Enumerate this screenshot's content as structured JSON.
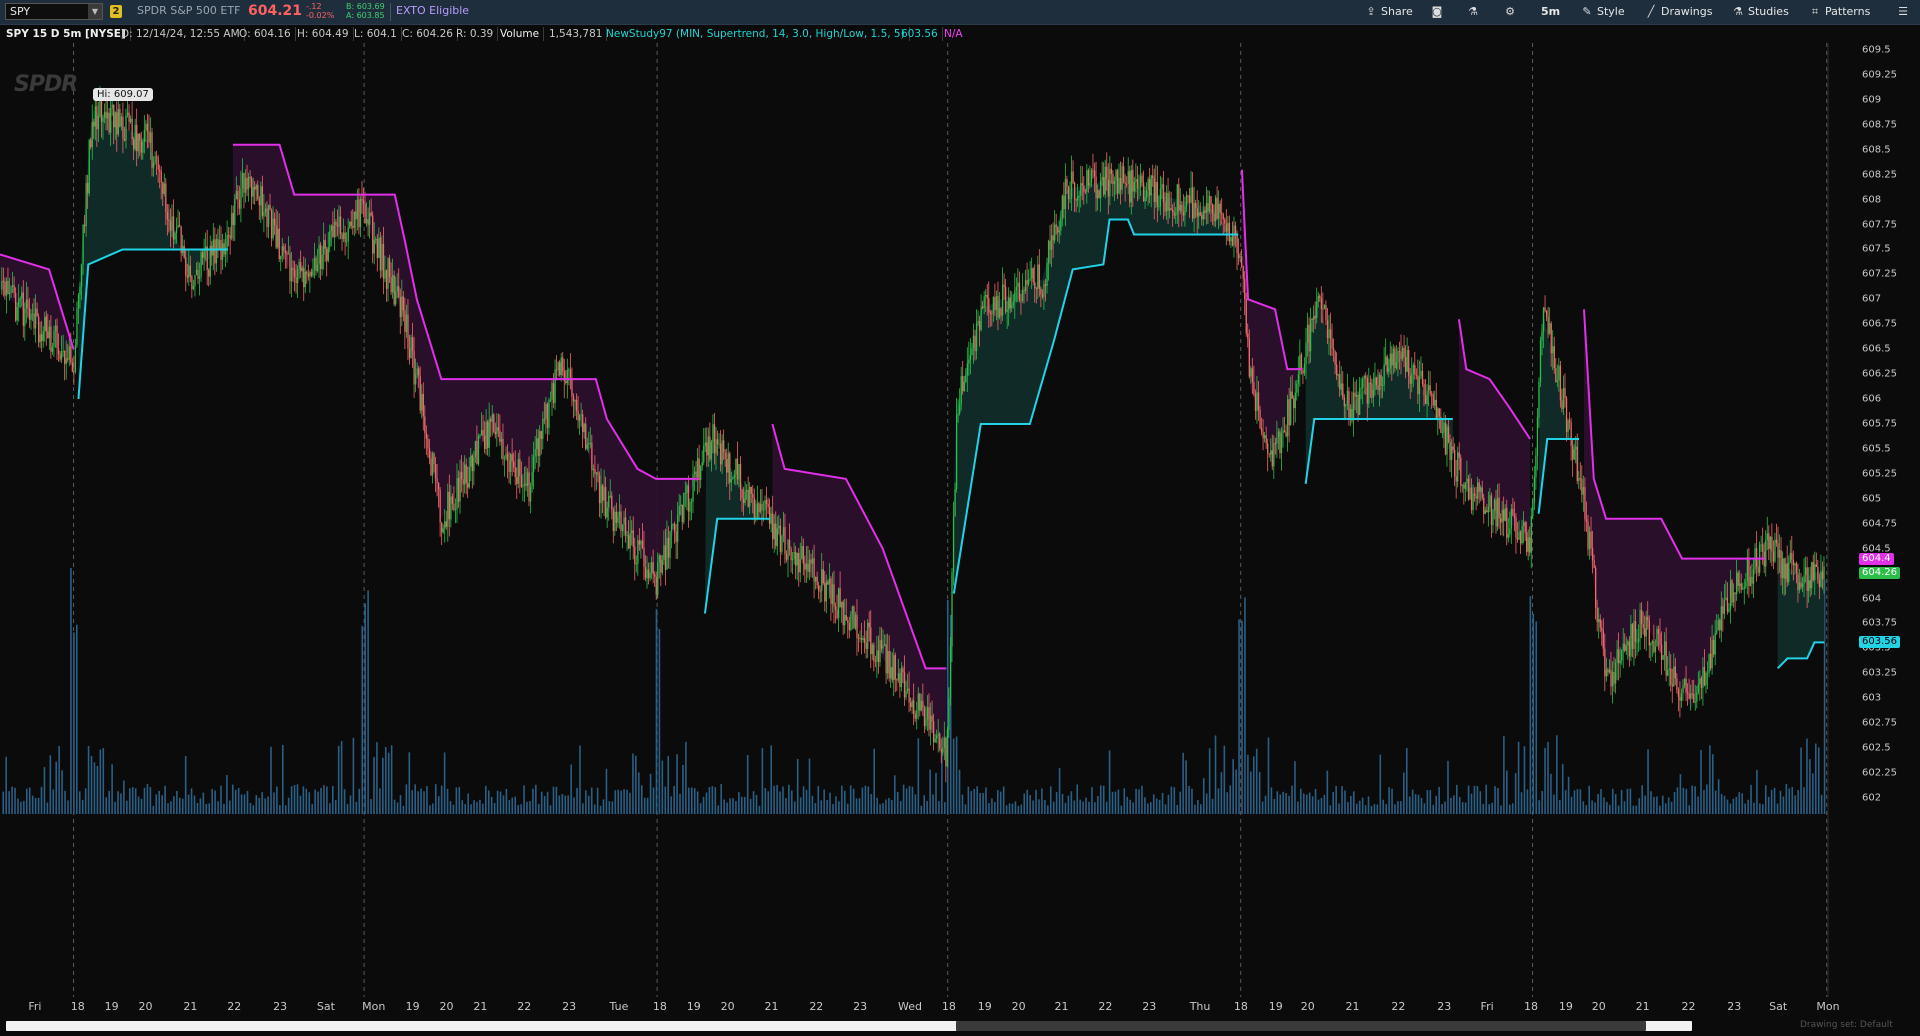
{
  "topbar": {
    "symbol": "SPY",
    "link_badge": "2",
    "description": "SPDR S&P 500 ETF",
    "last_price": "604.21",
    "change": "-.12",
    "change_pct": "-0.02%",
    "bid": "B: 603.69",
    "ask": "A: 603.85",
    "exto": "EXTO Eligible",
    "buttons": {
      "share": "Share",
      "timeframe": "5m",
      "style": "Style",
      "drawings": "Drawings",
      "studies": "Studies",
      "patterns": "Patterns"
    }
  },
  "inforow": {
    "title": "SPY 15 D 5m [NYSE]",
    "date": "D: 12/14/24, 12:55 AM",
    "open": "O: 604.16",
    "high": "H: 604.49",
    "low": "L: 604.1",
    "close": "C: 604.26",
    "range": "R: 0.39",
    "volume_label": "Volume",
    "volume_value": "1,543,781",
    "study": "NewStudy97 (MIN, Supertrend, 14, 3.0, High/Low, 1.5, 5)",
    "study_value": "603.56",
    "study_na": "N/A"
  },
  "chart": {
    "hi_flag": "Hi: 609.07",
    "logo_text": "SPDR",
    "price_badges": {
      "magenta": "604.4",
      "last": "604.26",
      "cyan": "603.56"
    },
    "colors": {
      "up": "#2bbf4a",
      "down": "#f06a6a",
      "supertrend_up": "#22d3e6",
      "supertrend_down": "#e030e8",
      "fill_up": "#0f2e2a",
      "fill_down": "#2e0f2f",
      "volume": "#2a5f86"
    }
  },
  "chart_data": {
    "type": "candlestick",
    "title": "SPY 15 D 5m [NYSE]",
    "y_ticks": [
      "609.5",
      "609.25",
      "609",
      "608.75",
      "608.5",
      "608.25",
      "608",
      "607.75",
      "607.5",
      "607.25",
      "607",
      "606.75",
      "606.5",
      "606.25",
      "606",
      "605.75",
      "605.5",
      "605.25",
      "605",
      "604.75",
      "604.5",
      "604.25",
      "604",
      "603.75",
      "603.5",
      "603.25",
      "603",
      "602.75",
      "602.5",
      "602.25",
      "602"
    ],
    "x_ticks": [
      "Fri",
      "18",
      "19",
      "20",
      "21",
      "22",
      "23",
      "Sat",
      "Mon",
      "19",
      "20",
      "21",
      "22",
      "23",
      "Tue",
      "18",
      "19",
      "20",
      "21",
      "22",
      "23",
      "Wed",
      "18",
      "19",
      "20",
      "21",
      "22",
      "23",
      "Thu",
      "18",
      "19",
      "20",
      "21",
      "22",
      "23",
      "Fri",
      "18",
      "19",
      "20",
      "21",
      "22",
      "23",
      "Sat",
      "Mon"
    ],
    "ylim": [
      601.95,
      609.55
    ],
    "session_path": [
      {
        "x": 0,
        "price": 607.1
      },
      {
        "x": 60,
        "price": 606.4
      },
      {
        "x": 75,
        "price": 608.9
      },
      {
        "x": 120,
        "price": 608.6
      },
      {
        "x": 155,
        "price": 607.2
      },
      {
        "x": 185,
        "price": 607.6
      },
      {
        "x": 200,
        "price": 608.3
      },
      {
        "x": 240,
        "price": 607.2
      },
      {
        "x": 295,
        "price": 607.9
      },
      {
        "x": 330,
        "price": 606.8
      },
      {
        "x": 360,
        "price": 604.8
      },
      {
        "x": 400,
        "price": 605.7
      },
      {
        "x": 430,
        "price": 605.1
      },
      {
        "x": 458,
        "price": 606.4
      },
      {
        "x": 490,
        "price": 605.0
      },
      {
        "x": 535,
        "price": 604.2
      },
      {
        "x": 580,
        "price": 605.6
      },
      {
        "x": 630,
        "price": 604.7
      },
      {
        "x": 680,
        "price": 604.0
      },
      {
        "x": 740,
        "price": 603.1
      },
      {
        "x": 772,
        "price": 602.4
      },
      {
        "x": 780,
        "price": 605.9
      },
      {
        "x": 800,
        "price": 606.9
      },
      {
        "x": 850,
        "price": 607.2
      },
      {
        "x": 870,
        "price": 608.1
      },
      {
        "x": 905,
        "price": 608.2
      },
      {
        "x": 930,
        "price": 608.1
      },
      {
        "x": 990,
        "price": 607.9
      },
      {
        "x": 1012,
        "price": 607.5
      },
      {
        "x": 1020,
        "price": 606.1
      },
      {
        "x": 1040,
        "price": 605.4
      },
      {
        "x": 1075,
        "price": 607.0
      },
      {
        "x": 1100,
        "price": 605.9
      },
      {
        "x": 1140,
        "price": 606.5
      },
      {
        "x": 1165,
        "price": 606.0
      },
      {
        "x": 1195,
        "price": 605.1
      },
      {
        "x": 1248,
        "price": 604.6
      },
      {
        "x": 1258,
        "price": 606.9
      },
      {
        "x": 1290,
        "price": 605.1
      },
      {
        "x": 1310,
        "price": 603.2
      },
      {
        "x": 1340,
        "price": 603.8
      },
      {
        "x": 1380,
        "price": 602.9
      },
      {
        "x": 1410,
        "price": 604.0
      },
      {
        "x": 1440,
        "price": 604.5
      },
      {
        "x": 1470,
        "price": 604.2
      },
      {
        "x": 1488,
        "price": 604.3
      }
    ],
    "supertrend_segments": [
      {
        "dir": "down",
        "points": [
          [
            0,
            607.45
          ],
          [
            40,
            607.3
          ],
          [
            60,
            606.5
          ]
        ]
      },
      {
        "dir": "up",
        "points": [
          [
            64,
            606.0
          ],
          [
            72,
            607.35
          ],
          [
            100,
            607.5
          ],
          [
            186,
            607.5
          ]
        ]
      },
      {
        "dir": "down",
        "points": [
          [
            190,
            608.55
          ],
          [
            228,
            608.55
          ],
          [
            240,
            608.05
          ],
          [
            322,
            608.05
          ],
          [
            330,
            607.6
          ],
          [
            340,
            607.0
          ],
          [
            360,
            606.2
          ],
          [
            486,
            606.2
          ],
          [
            495,
            605.8
          ],
          [
            520,
            605.3
          ],
          [
            535,
            605.2
          ],
          [
            570,
            605.2
          ]
        ]
      },
      {
        "dir": "up",
        "points": [
          [
            575,
            603.85
          ],
          [
            585,
            604.8
          ],
          [
            628,
            604.8
          ]
        ]
      },
      {
        "dir": "down",
        "points": [
          [
            630,
            605.75
          ],
          [
            640,
            605.3
          ],
          [
            690,
            605.2
          ],
          [
            720,
            604.5
          ],
          [
            755,
            603.3
          ],
          [
            772,
            603.3
          ]
        ]
      },
      {
        "dir": "up",
        "points": [
          [
            778,
            604.05
          ],
          [
            800,
            605.75
          ],
          [
            840,
            605.75
          ],
          [
            860,
            606.6
          ],
          [
            875,
            607.3
          ],
          [
            900,
            607.35
          ],
          [
            905,
            607.8
          ],
          [
            920,
            607.8
          ],
          [
            925,
            607.65
          ],
          [
            1010,
            607.65
          ]
        ]
      },
      {
        "dir": "down",
        "points": [
          [
            1013,
            608.3
          ],
          [
            1018,
            607.0
          ],
          [
            1040,
            606.9
          ],
          [
            1050,
            606.3
          ],
          [
            1062,
            606.3
          ]
        ]
      },
      {
        "dir": "up",
        "points": [
          [
            1065,
            605.15
          ],
          [
            1072,
            605.8
          ],
          [
            1110,
            605.8
          ],
          [
            1185,
            605.8
          ]
        ]
      },
      {
        "dir": "down",
        "points": [
          [
            1190,
            606.8
          ],
          [
            1196,
            606.3
          ],
          [
            1215,
            606.2
          ],
          [
            1232,
            605.9
          ],
          [
            1248,
            605.6
          ]
        ]
      },
      {
        "dir": "up",
        "points": [
          [
            1255,
            604.85
          ],
          [
            1262,
            605.6
          ],
          [
            1288,
            605.6
          ]
        ]
      },
      {
        "dir": "down",
        "points": [
          [
            1292,
            606.9
          ],
          [
            1300,
            605.2
          ],
          [
            1310,
            604.8
          ],
          [
            1355,
            604.8
          ],
          [
            1372,
            604.4
          ],
          [
            1440,
            604.4
          ]
        ]
      },
      {
        "dir": "up",
        "points": [
          [
            1450,
            603.3
          ],
          [
            1458,
            603.4
          ],
          [
            1474,
            603.4
          ],
          [
            1480,
            603.56
          ],
          [
            1488,
            603.56
          ]
        ]
      }
    ],
    "session_breaks_x": [
      60,
      297,
      536,
      773,
      1012,
      1250,
      1490
    ],
    "legend": [
      "Volume",
      "NewStudy97 (MIN, Supertrend, 14, 3.0, High/Low, 1.5, 5)"
    ]
  },
  "scrollbar": {
    "drawing_set": "Drawing set: Default"
  }
}
